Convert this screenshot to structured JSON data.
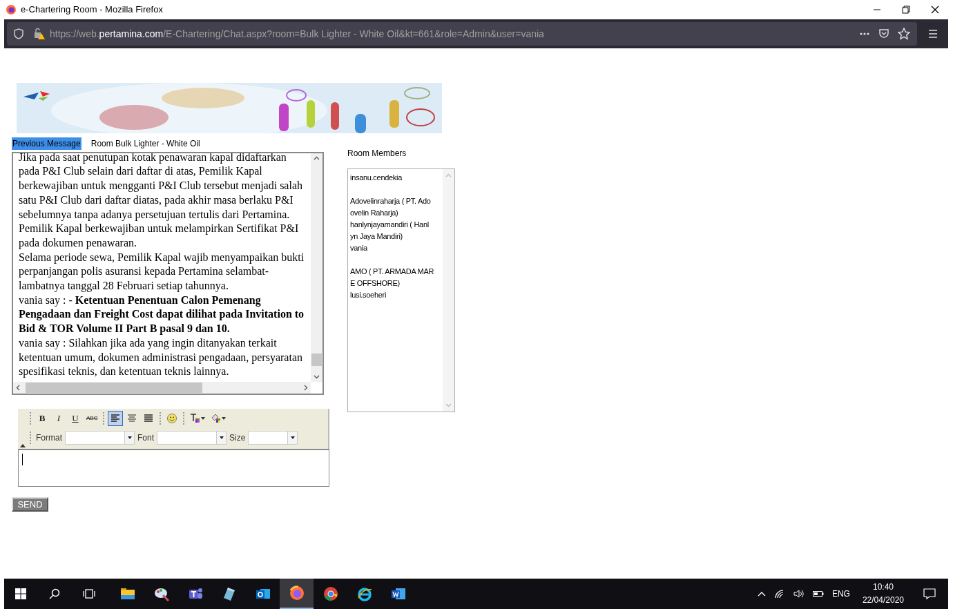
{
  "window": {
    "title": "e-Chartering Room - Mozilla Firefox"
  },
  "address_bar": {
    "url_scheme": "https://web.",
    "url_domain": "pertamina.com",
    "url_path": "/E-Chartering/Chat.aspx?room=Bulk Lighter - White Oil&kt=661&role=Admin&user=vania"
  },
  "room_links": [
    {
      "label": "Previous Message",
      "selected": true
    },
    {
      "label": "Room Bulk Lighter - White Oil",
      "selected": false
    }
  ],
  "messages": [
    "Jika pada saat penutupan kotak penawaran kapal didaftarkan pada P&I Club selain dari daftar di atas, Pemilik Kapal berkewajiban untuk mengganti P&I Club tersebut menjadi salah satu P&I Club dari daftar diatas, pada akhir masa berlaku P&I sebelumnya tanpa adanya persetujuan tertulis dari Pertamina.",
    "Pemilik Kapal berkewajiban untuk melampirkan Sertifikat P&I pada dokumen penawaran.",
    "Selama periode sewa, Pemilik Kapal wajib menyampaikan bukti perpanjangan polis asuransi kepada Pertamina selambat-lambatnya tanggal 28 Februari setiap tahunnya.",
    "vania say : - **Ketentuan Penentuan Calon Pemenang Pengadaan dan Freight Cost dapat dilihat pada Invitation to Bid & TOR Volume II Part B pasal 9 dan 10.**",
    "vania say : Silahkan jika ada yang ingin ditanyakan terkait ketentuan umum, dokumen administrasi pengadaan, persyaratan spesifikasi teknis, dan ketentuan teknis lainnya."
  ],
  "room_members": {
    "title": "Room Members",
    "groups": [
      [
        {
          "lines": [
            "insanu.cendekia"
          ]
        }
      ],
      [
        {
          "lines": [
            "Adovelinraharja ( PT. Ado",
            "ovelin Raharja)"
          ]
        },
        {
          "lines": [
            "hanlynjayamandiri ( Hanl",
            "yn Jaya Mandiri)"
          ]
        },
        {
          "lines": [
            "vania"
          ]
        }
      ],
      [
        {
          "lines": [
            "AMO ( PT. ARMADA MAR",
            "E OFFSHORE)"
          ]
        },
        {
          "lines": [
            "lusi.soeheri"
          ]
        }
      ]
    ]
  },
  "editor": {
    "toolbar": [
      {
        "kind": "bold",
        "label": "B",
        "selected": false
      },
      {
        "kind": "italic",
        "label": "I",
        "selected": false
      },
      {
        "kind": "underline",
        "label": "U",
        "selected": false
      },
      {
        "kind": "strike",
        "label": "ABC",
        "selected": false
      },
      {
        "kind": "align-left",
        "selected": true
      },
      {
        "kind": "align-center",
        "selected": false
      },
      {
        "kind": "justify",
        "selected": false
      },
      {
        "kind": "smiley",
        "selected": false
      },
      {
        "kind": "text-color",
        "selected": false
      },
      {
        "kind": "bg-color",
        "selected": false
      }
    ],
    "dropdowns": [
      {
        "label": "Format"
      },
      {
        "label": "Font"
      },
      {
        "label": "Size"
      }
    ]
  },
  "send_button": "SEND",
  "taskbar": {
    "apps": [
      {
        "kind": "explorer",
        "active": false
      },
      {
        "kind": "paint",
        "active": false
      },
      {
        "kind": "teams",
        "active": false
      },
      {
        "kind": "notes",
        "active": false
      },
      {
        "kind": "outlook",
        "active": false
      },
      {
        "kind": "firefox",
        "active": true
      },
      {
        "kind": "chrome",
        "active": false
      },
      {
        "kind": "ie",
        "active": false
      },
      {
        "kind": "word",
        "active": false
      }
    ],
    "language": "ENG",
    "time": "10:40",
    "date": "22/04/2020"
  }
}
